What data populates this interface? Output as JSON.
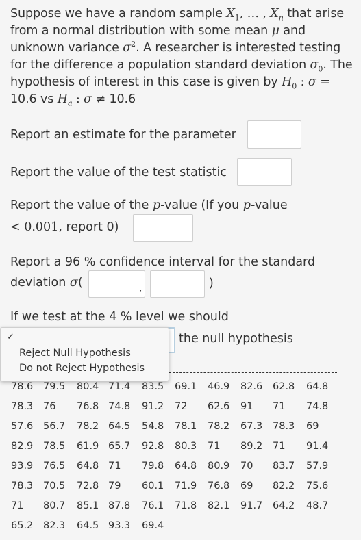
{
  "intro": {
    "p1": "Suppose we have a random sample ",
    "p2": " that arise from a normal distribution with some mean ",
    "p3": " and unknown variance ",
    "p4": ". A researcher is interested testing for the difference a population standard deviation ",
    "p5": ". The hypothesis of interest in this case is given by ",
    "p6": " = 10.6 vs ",
    "p7": " 10.6"
  },
  "q1": {
    "label": "Report an estimate for the parameter"
  },
  "q2": {
    "label": "Report the value of the test statistic"
  },
  "q3": {
    "line1": "Report the value of the ",
    "line1b": "-value (If you ",
    "line1c": "-value",
    "line2b": ", report 0)"
  },
  "q4": {
    "line1": "Report a 96 % confidence interval for the standard",
    "line2": "deviation ",
    "comma": ",",
    "close": ")"
  },
  "q5": {
    "line1": "If we test at the 4 % level we should",
    "after": "the null hypothesis"
  },
  "dropdown": {
    "check": "✓",
    "options": [
      "Reject Null Hypothesis",
      "Do not Reject Hypothesis"
    ]
  },
  "data_values": [
    [
      "78.6",
      "79.5",
      "80.4",
      "71.4",
      "83.5",
      "69.1",
      "46.9",
      "82.6",
      "62.8",
      "64.8"
    ],
    [
      "78.3",
      "76",
      "76.8",
      "74.8",
      "91.2",
      "72",
      "62.6",
      "91",
      "71",
      "74.8"
    ],
    [
      "57.6",
      "56.7",
      "78.2",
      "64.5",
      "54.8",
      "78.1",
      "78.2",
      "67.3",
      "78.3",
      "69"
    ],
    [
      "82.9",
      "78.5",
      "61.9",
      "65.7",
      "92.8",
      "80.3",
      "71",
      "89.2",
      "71",
      "91.4"
    ],
    [
      "93.9",
      "76.5",
      "64.8",
      "71",
      "79.8",
      "64.8",
      "80.9",
      "70",
      "83.7",
      "57.9"
    ],
    [
      "78.3",
      "70.5",
      "72.8",
      "79",
      "60.1",
      "71.9",
      "76.8",
      "69",
      "82.2",
      "75.6"
    ],
    [
      "71",
      "80.7",
      "85.1",
      "87.8",
      "76.1",
      "71.8",
      "82.1",
      "91.7",
      "64.2",
      "48.7"
    ],
    [
      "65.2",
      "82.3",
      "64.5",
      "93.3",
      "69.4"
    ]
  ]
}
